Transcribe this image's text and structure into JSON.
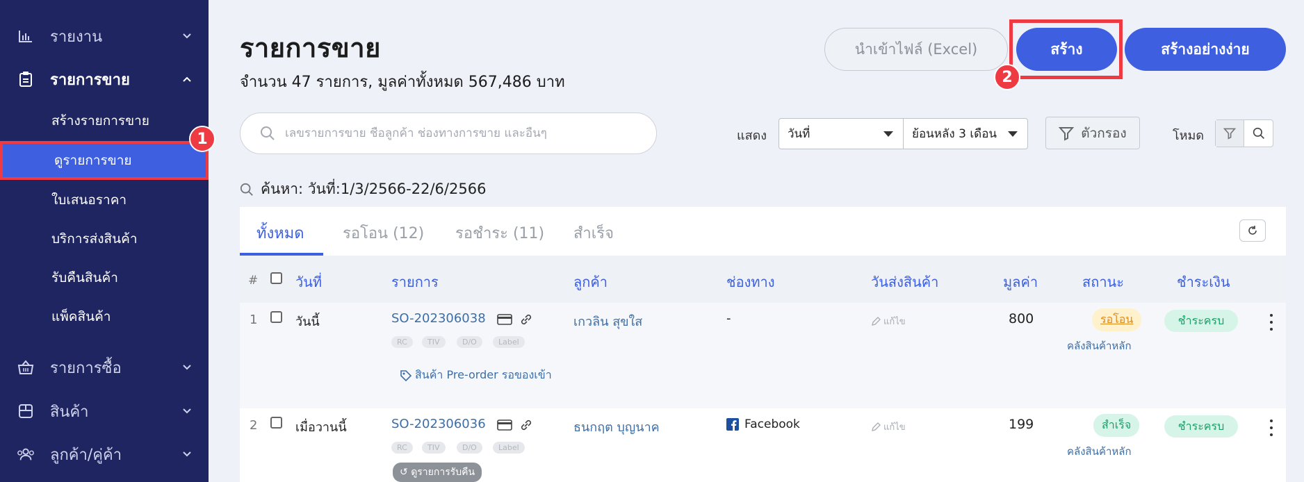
{
  "sidebar": {
    "items": [
      {
        "label": "รายงาน",
        "icon": "chart-icon"
      },
      {
        "label": "รายการขาย",
        "icon": "clipboard-icon"
      },
      {
        "label": "รายการซื้อ",
        "icon": "basket-icon"
      },
      {
        "label": "สินค้า",
        "icon": "box-icon"
      },
      {
        "label": "ลูกค้า/คู่ค้า",
        "icon": "users-icon"
      }
    ],
    "sub_items": [
      {
        "label": "สร้างรายการขาย"
      },
      {
        "label": "ดูรายการขาย"
      },
      {
        "label": "ใบเสนอราคา"
      },
      {
        "label": "บริการส่งสินค้า"
      },
      {
        "label": "รับคืนสินค้า"
      },
      {
        "label": "แพ็คสินค้า"
      }
    ]
  },
  "annotations": {
    "one": "1",
    "two": "2"
  },
  "header": {
    "title": "รายการขาย",
    "subtitle": "จำนวน 47 รายการ, มูลค่าทั้งหมด 567,486 บาท",
    "import_label": "นำเข้าไฟล์ (Excel)",
    "create_label": "สร้าง",
    "easy_create_label": "สร้างอย่างง่าย"
  },
  "search": {
    "placeholder": "เลขรายการขาย ชื่อลูกค้า ช่องทางการขาย และอื่นๆ"
  },
  "toolbar": {
    "show_label": "แสดง",
    "date_type": "วันที่",
    "date_range": "ย้อนหลัง 3 เดือน",
    "filter_label": "ตัวกรอง",
    "mode_label": "โหมด"
  },
  "query": "ค้นหา: วันที่:1/3/2566-22/6/2566",
  "tabs": [
    {
      "label": "ทั้งหมด"
    },
    {
      "label": "รอโอน (12)"
    },
    {
      "label": "รอชำระ (11)"
    },
    {
      "label": "สำเร็จ"
    }
  ],
  "table": {
    "columns": {
      "hash": "#",
      "date": "วันที่",
      "order": "รายการ",
      "customer": "ลูกค้า",
      "channel": "ช่องทาง",
      "ship_date": "วันส่งสินค้า",
      "value": "มูลค่า",
      "status": "สถานะ",
      "payment": "ชำระเงิน"
    },
    "mini_tags": {
      "rc": "RC",
      "tiv": "TIV",
      "do": "D/O",
      "label": "Label"
    },
    "edit_label": "แก้ไข",
    "rows": [
      {
        "index": "1",
        "date": "วันนี้",
        "order": "SO-202306038",
        "customer": "เกวลิน สุขใส",
        "channel": "-",
        "value": "800",
        "status": "รอโอน",
        "warehouse": "คลังสินค้าหลัก",
        "payment": "ชำระครบ",
        "note": "สินค้า Pre-order รอของเข้า"
      },
      {
        "index": "2",
        "date": "เมื่อวานนี้",
        "order": "SO-202306036",
        "customer": "ธนกฤต บุญนาค",
        "channel": "Facebook",
        "value": "199",
        "status": "สำเร็จ",
        "warehouse": "คลังสินค้าหลัก",
        "payment": "ชำระครบ",
        "note": "ดูรายการรับคืน"
      }
    ]
  }
}
